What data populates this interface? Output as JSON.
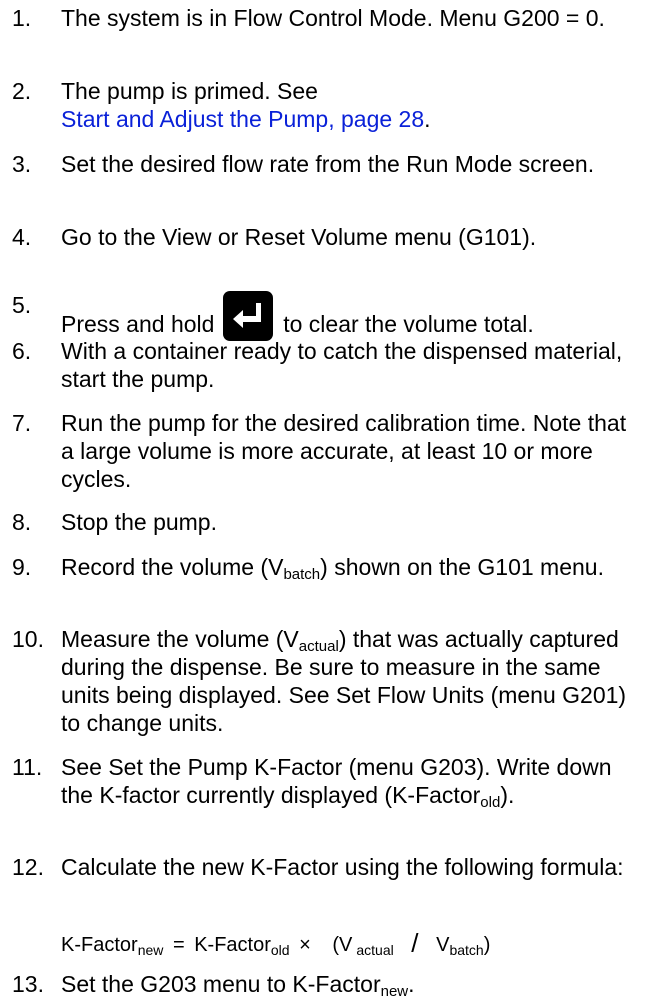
{
  "steps": [
    {
      "num": "1.",
      "text": "The system is in Flow Control Mode. Menu G200 = 0."
    },
    {
      "num": "2.",
      "text": "The pump is primed.   See",
      "link": "Start and Adjust the Pump, page 28",
      "after_link": "."
    },
    {
      "num": "3.",
      "text": "Set the desired flow rate from the Run Mode screen."
    },
    {
      "num": "4.",
      "text": "Go to the View or Reset Volume menu (G101)."
    },
    {
      "num": "5.",
      "text_before": "Press and hold",
      "text_after": "to clear the volume total."
    },
    {
      "num": "6.",
      "text": "With a container ready to catch the dispensed material, start the pump."
    },
    {
      "num": "7.",
      "text": "Run the pump for the desired calibration time. Note that a large volume is more accurate, at least 10 or more cycles."
    },
    {
      "num": "8.",
      "text": "Stop the pump."
    },
    {
      "num": "9.",
      "text_before": "Record the volume (V",
      "sub": "batch",
      "text_after": ") shown on the G101 menu."
    },
    {
      "num": "10.",
      "text_before": "Measure the volume (V",
      "sub": "actual",
      "text_after": ") that was actually captured during the dispense.  Be sure to measure in the same units being displayed. See Set Flow Units (menu G201) to change units."
    },
    {
      "num": "11.",
      "text_before": "See Set the Pump K-Factor (menu G203). Write down the K-factor currently displayed (K-Factor",
      "sub": "old",
      "text_after": ")."
    },
    {
      "num": "12.",
      "text": "Calculate the new K-Factor using the following formula:"
    },
    {
      "num": "13.",
      "text_before": "Set the G203 menu to K-Factor",
      "sub": "new",
      "text_after": "."
    }
  ],
  "formula": {
    "lhs": "K-Factor",
    "lhs_sub": "new",
    "eq": "=",
    "rhs": "K-Factor",
    "rhs_sub": "old",
    "times": "×",
    "open": "(V",
    "num_sub": "actual",
    "slash": "/",
    "den": "V",
    "den_sub": "batch",
    "close": ")"
  },
  "icons": {
    "enter": "enter-key-icon"
  },
  "colors": {
    "link": "#0a21d8",
    "text": "#000000"
  }
}
